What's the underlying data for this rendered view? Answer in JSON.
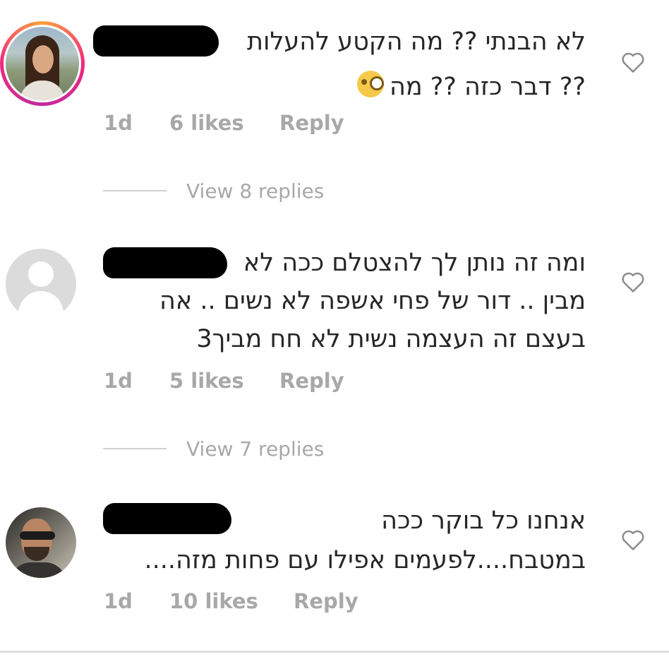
{
  "comments": [
    {
      "lines": [
        "לא הבנתי ?? מה הקטע להעלות",
        "?? דבר כזה ?? מה"
      ],
      "emoji_icon": "monocle-face-emoji-icon",
      "time": "1d",
      "likes": "6 likes",
      "reply": "Reply",
      "view_replies": "View 8 replies"
    },
    {
      "lines": [
        "ומה זה נותן לך להצטלם ככה לא",
        "מבין .. דור של פחי אשפה לא נשים .. אה",
        "בעצם זה העצמה נשית לא חח מביך3"
      ],
      "time": "1d",
      "likes": "5 likes",
      "reply": "Reply",
      "view_replies": "View 7 replies"
    },
    {
      "lines": [
        "אנחנו כל בוקר ככה",
        "במטבח....לפעמים אפילו עם פחות מזה...."
      ],
      "time": "1d",
      "likes": "10 likes",
      "reply": "Reply"
    }
  ],
  "icons": {
    "like": "heart-outline-icon",
    "avatar_default": "default-user-avatar-icon"
  },
  "colors": {
    "text": "#262626",
    "meta": "#a8a8a8",
    "story_ring": "#ee2a7b"
  }
}
